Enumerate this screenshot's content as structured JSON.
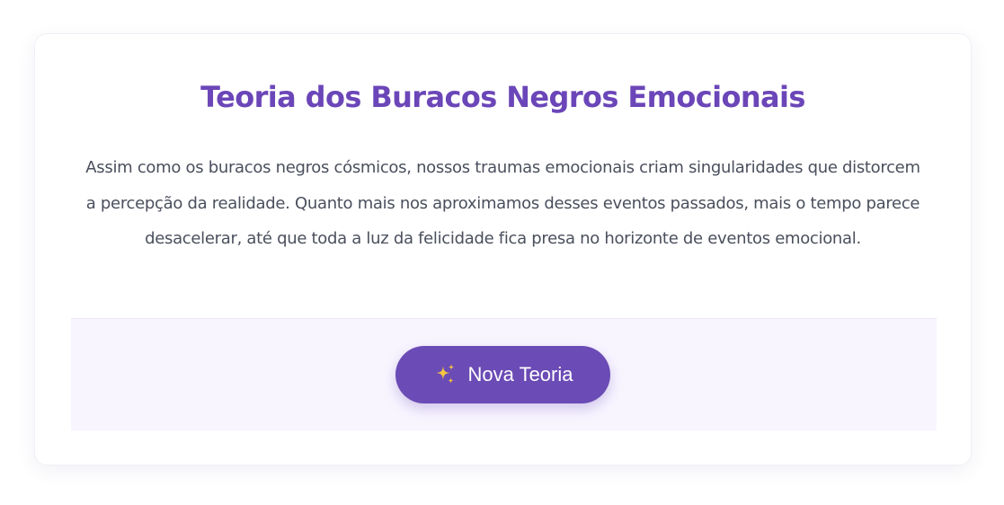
{
  "card": {
    "title": "Teoria dos Buracos Negros Emocionais",
    "description": "Assim como os buracos negros cósmicos, nossos traumas emocionais criam singularidades que distorcem a percepção da realidade. Quanto mais nos aproximamos desses eventos passados, mais o tempo parece desacelerar, até que toda a luz da felicidade fica presa no horizonte de eventos emocional."
  },
  "action": {
    "button_label": "Nova Teoria",
    "button_icon": "sparkles-icon"
  },
  "colors": {
    "title": "#6b46b8",
    "button": "#6b4bb5",
    "panel_background": "#f8f5ff",
    "sparkle": "#f5c542"
  }
}
